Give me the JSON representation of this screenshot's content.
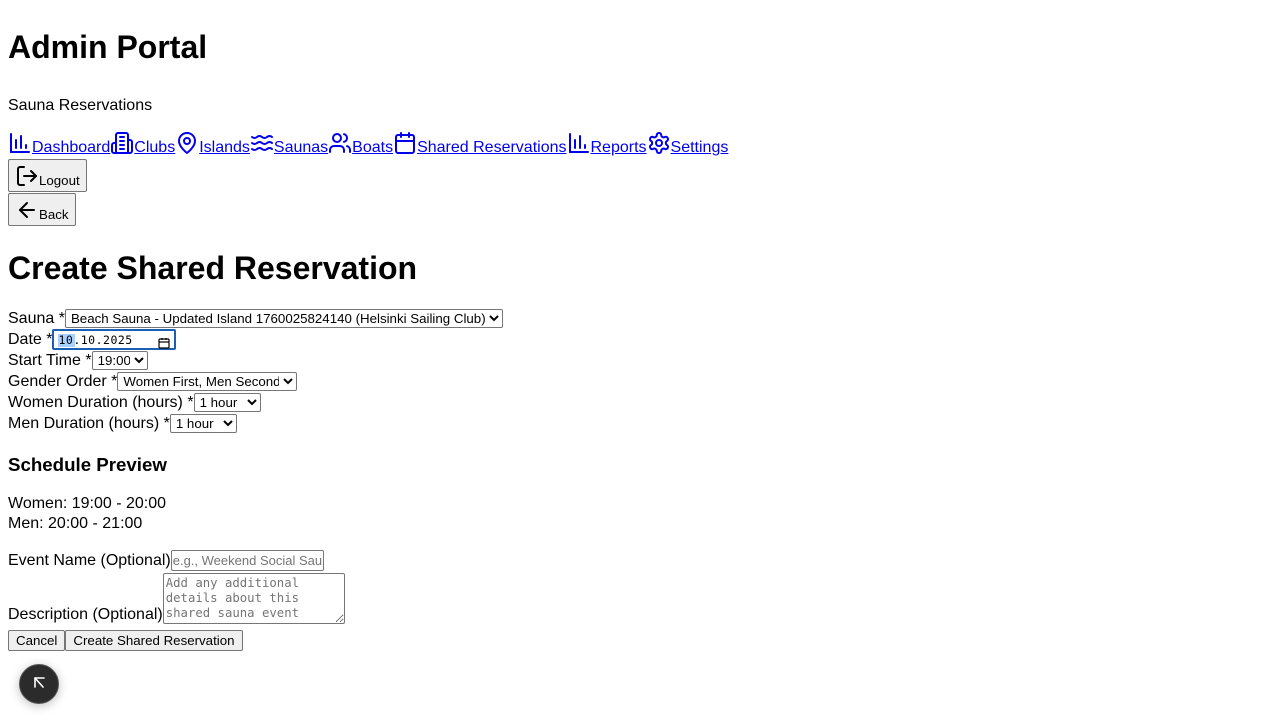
{
  "header": {
    "title": "Admin Portal",
    "subtitle": "Sauna Reservations"
  },
  "nav": {
    "items": [
      {
        "label": "Dashboard",
        "icon": "bar-chart-icon"
      },
      {
        "label": "Clubs",
        "icon": "building-icon"
      },
      {
        "label": "Islands",
        "icon": "map-pin-icon"
      },
      {
        "label": "Saunas",
        "icon": "waves-icon"
      },
      {
        "label": "Boats",
        "icon": "users-icon"
      },
      {
        "label": "Shared Reservations",
        "icon": "calendar-icon"
      },
      {
        "label": "Reports",
        "icon": "bar-chart-icon"
      },
      {
        "label": "Settings",
        "icon": "gear-icon"
      }
    ]
  },
  "buttons": {
    "logout": "Logout",
    "back": "Back",
    "cancel": "Cancel",
    "submit": "Create Shared Reservation"
  },
  "page": {
    "title": "Create Shared Reservation"
  },
  "form": {
    "sauna": {
      "label": "Sauna *",
      "value": "Beach Sauna - Updated Island 1760025824140 (Helsinki Sailing Club)"
    },
    "date": {
      "label": "Date *",
      "value": "10.10.2025",
      "day": "10",
      "rest": ".10.2025"
    },
    "start_time": {
      "label": "Start Time *",
      "value": "19:00"
    },
    "gender_order": {
      "label": "Gender Order *",
      "value": "Women First, Men Second"
    },
    "women_duration": {
      "label": "Women Duration (hours) *",
      "value": "1 hour"
    },
    "men_duration": {
      "label": "Men Duration (hours) *",
      "value": "1 hour"
    },
    "event_name": {
      "label": "Event Name (Optional)",
      "placeholder": "e.g., Weekend Social Sauna"
    },
    "description": {
      "label": "Description (Optional)",
      "placeholder": "Add any additional details about this shared sauna event"
    }
  },
  "preview": {
    "title": "Schedule Preview",
    "women": "Women: 19:00 - 20:00",
    "men": "Men: 20:00 - 21:00"
  },
  "colors": {
    "link": "#0000ee",
    "focus": "#1a5fb4",
    "date_selection": "#a8d1ff",
    "fab_background": "#2b2b2b"
  }
}
